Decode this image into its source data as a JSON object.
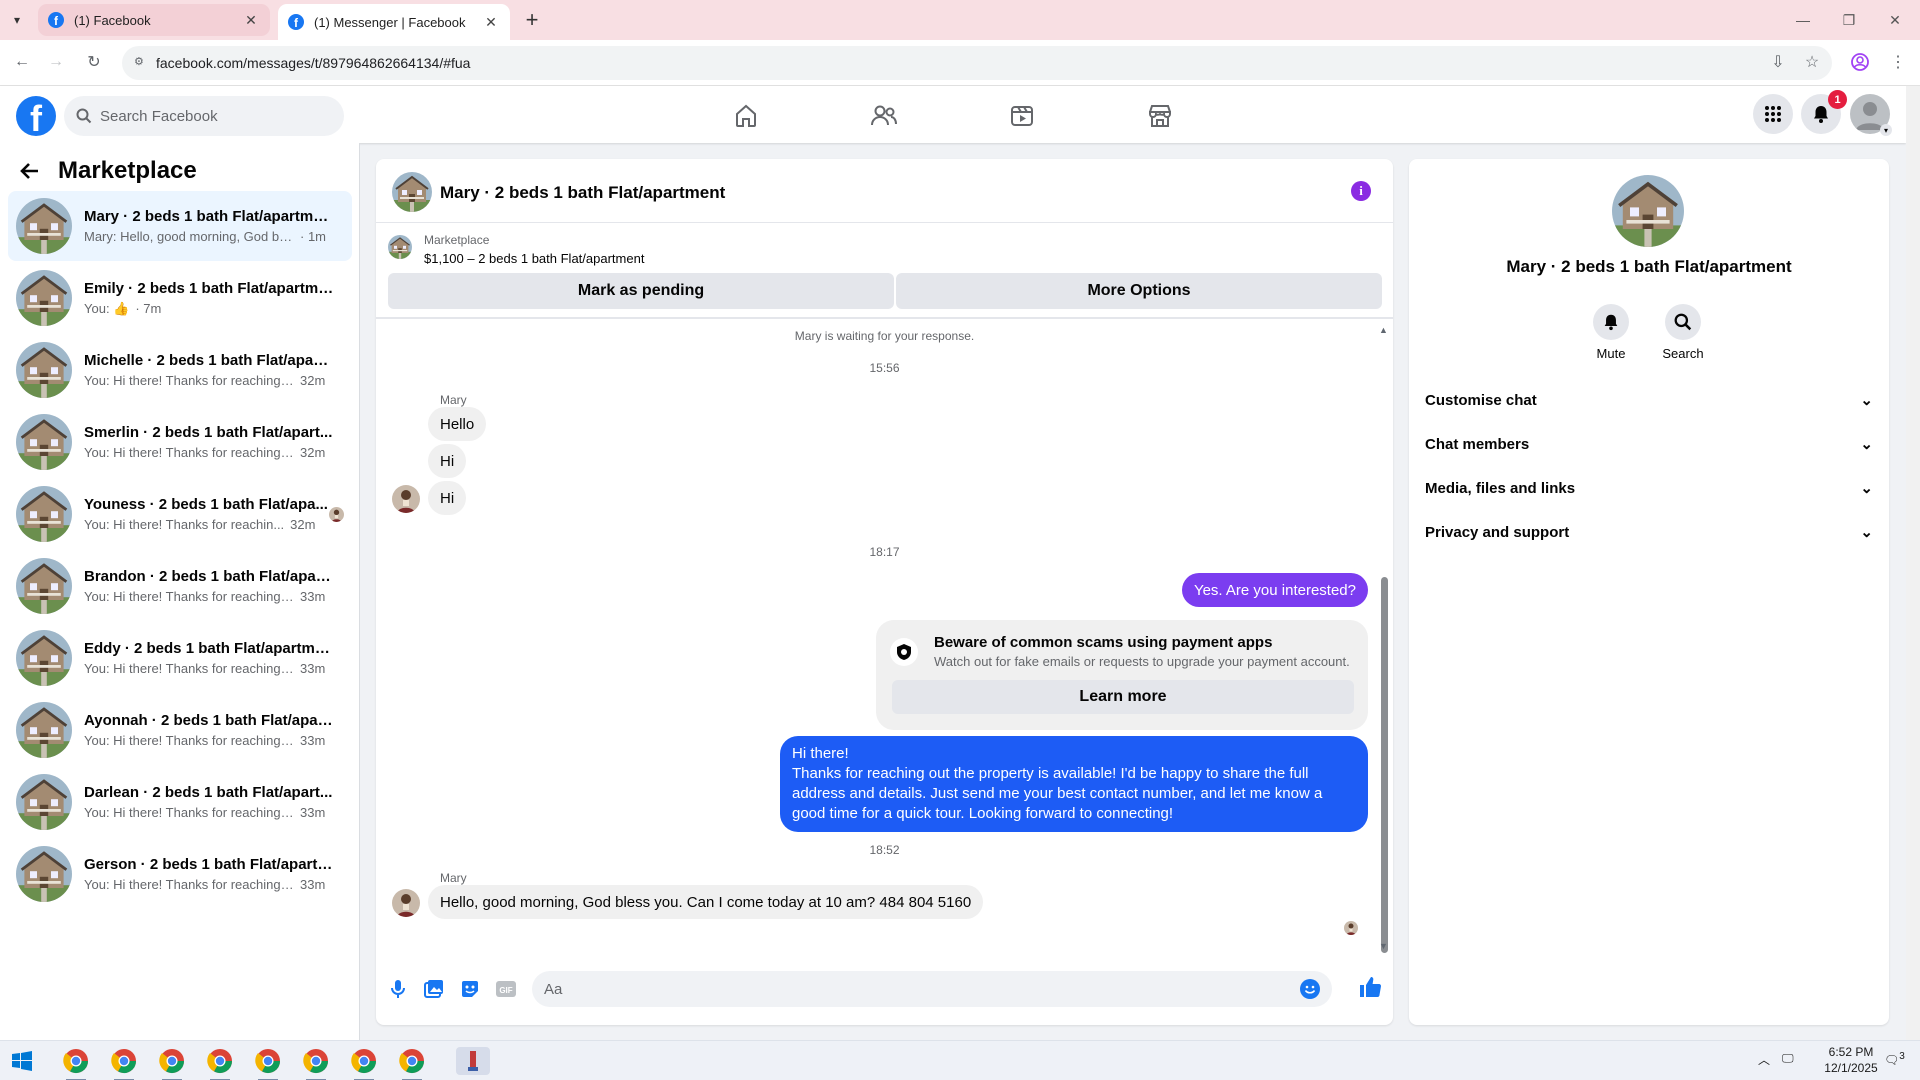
{
  "browser": {
    "tabs": [
      {
        "title": "(1) Facebook",
        "active": false
      },
      {
        "title": "(1) Messenger | Facebook",
        "active": true
      }
    ],
    "url": "facebook.com/messages/t/897964862664134/#fua",
    "new_tab_label": "+"
  },
  "fb_header": {
    "logo": "f",
    "search_placeholder": "Search Facebook",
    "nav_icons": [
      "home-icon",
      "friends-icon",
      "watch-icon",
      "marketplace-icon"
    ],
    "notification_count": "1"
  },
  "sidebar": {
    "title": "Marketplace",
    "conversations": [
      {
        "name": "Mary · 2 beds 1 bath Flat/apartment",
        "preview": "Mary: Hello, good morning, God bles...",
        "time": "· 1m",
        "active": true
      },
      {
        "name": "Emily · 2 beds 1 bath Flat/apartment",
        "preview": "You: 👍",
        "time": "· 7m",
        "active": false
      },
      {
        "name": "Michelle · 2 beds 1 bath Flat/apart...",
        "preview": "You: Hi there! Thanks for reaching o...",
        "time": "32m",
        "active": false
      },
      {
        "name": "Smerlin · 2 beds 1 bath Flat/apart...",
        "preview": "You: Hi there! Thanks for reaching o...",
        "time": "32m",
        "active": false
      },
      {
        "name": "Youness · 2 beds 1 bath Flat/apa...",
        "preview": "You: Hi there! Thanks for reachin...",
        "time": "32m",
        "active": false,
        "seen_avatar": true
      },
      {
        "name": "Brandon · 2 beds 1 bath Flat/apart...",
        "preview": "You: Hi there! Thanks for reaching o...",
        "time": "33m",
        "active": false
      },
      {
        "name": "Eddy · 2 beds 1 bath Flat/apartment",
        "preview": "You: Hi there! Thanks for reaching o...",
        "time": "33m",
        "active": false
      },
      {
        "name": "Ayonnah · 2 beds 1 bath Flat/apart...",
        "preview": "You: Hi there! Thanks for reaching o...",
        "time": "33m",
        "active": false
      },
      {
        "name": "Darlean · 2 beds 1 bath Flat/apart...",
        "preview": "You: Hi there! Thanks for reaching o...",
        "time": "33m",
        "active": false
      },
      {
        "name": "Gerson · 2 beds 1 bath Flat/apartm...",
        "preview": "You: Hi there! Thanks for reaching o...",
        "time": "33m",
        "active": false
      }
    ]
  },
  "chat": {
    "title": "Mary · 2 beds 1 bath Flat/apartment",
    "listing_source": "Marketplace",
    "listing_desc": "$1,100 – 2 beds 1 bath Flat/apartment",
    "mark_pending": "Mark as pending",
    "more_options": "More Options",
    "waiting": "Mary is waiting for your response.",
    "time1": "15:56",
    "sender1": "Mary",
    "in1": "Hello",
    "in2": "Hi",
    "in3": "Hi",
    "time2": "18:17",
    "out1": "Yes. Are you interested?",
    "scam_title": "Beware of common scams using payment apps",
    "scam_desc": "Watch out for fake emails or requests to upgrade your payment account.",
    "learn_more": "Learn more",
    "out2_lines": [
      "Hi there!",
      "Thanks for reaching out the property is available! I'd be happy to share the full",
      "address and details. Just send me your best contact number, and let me know a",
      "good time for a quick tour. Looking forward to connecting!"
    ],
    "time3": "18:52",
    "sender2": "Mary",
    "in4": "Hello, good morning, God bless you. Can I come today at 10 am? 484 804 5160",
    "composer_placeholder": "Aa"
  },
  "right_panel": {
    "title": "Mary · 2 beds 1 bath Flat/apartment",
    "mute": "Mute",
    "search": "Search",
    "sections": [
      "Customise chat",
      "Chat members",
      "Media, files and links",
      "Privacy and support"
    ]
  },
  "taskbar": {
    "time": "6:52 PM",
    "date": "12/1/2025",
    "notifications": "3"
  },
  "colors": {
    "brand": "#1877f2",
    "outgoing_purple": "#7b3df0",
    "outgoing_blue": "#1d5cf5"
  }
}
